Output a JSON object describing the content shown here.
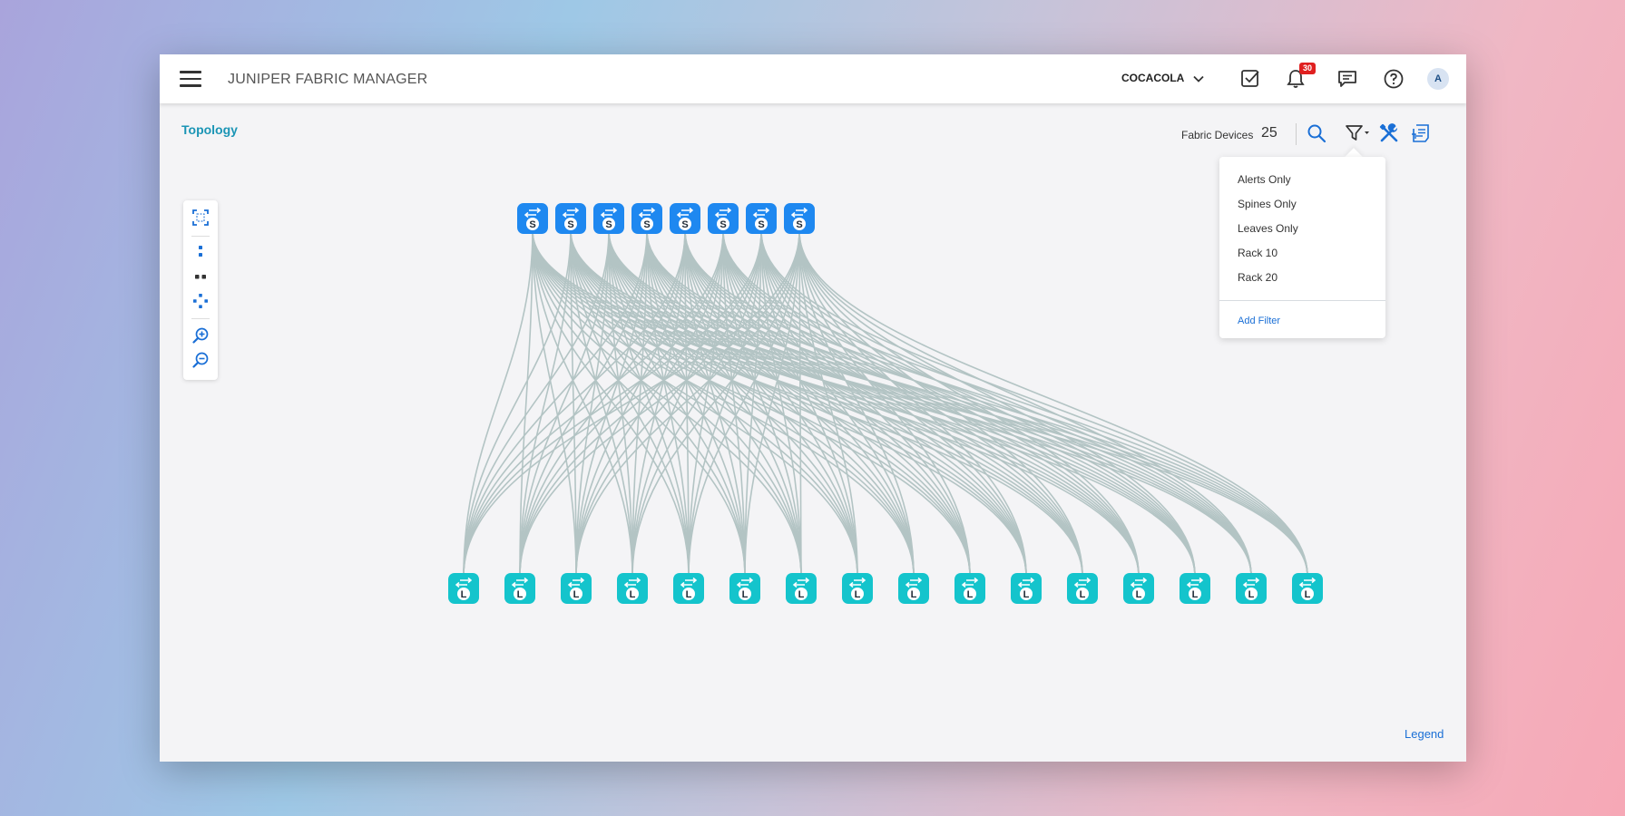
{
  "app": {
    "title": "JUNIPER FABRIC MANAGER",
    "tenant": "COCACOLA",
    "notification_count": "30",
    "user_initial": "A"
  },
  "page": {
    "title": "Topology",
    "fabric_devices_label": "Fabric Devices",
    "fabric_devices_count": "25"
  },
  "filter_menu": {
    "items": [
      "Alerts Only",
      "Spines Only",
      "Leaves Only",
      "Rack 10",
      "Rack 20"
    ],
    "add_filter": "Add Filter"
  },
  "topology": {
    "spines": [
      {
        "label": "S"
      },
      {
        "label": "S"
      },
      {
        "label": "S"
      },
      {
        "label": "S"
      },
      {
        "label": "S"
      },
      {
        "label": "S"
      },
      {
        "label": "S"
      },
      {
        "label": "S"
      }
    ],
    "leaves": [
      {
        "label": "L"
      },
      {
        "label": "L"
      },
      {
        "label": "L"
      },
      {
        "label": "L"
      },
      {
        "label": "L"
      },
      {
        "label": "L"
      },
      {
        "label": "L"
      },
      {
        "label": "L"
      },
      {
        "label": "L"
      },
      {
        "label": "L"
      },
      {
        "label": "L"
      },
      {
        "label": "L"
      },
      {
        "label": "L"
      },
      {
        "label": "L"
      },
      {
        "label": "L"
      },
      {
        "label": "L"
      }
    ],
    "link_color": "#b3c4c4",
    "spine_color": "#1e88f0",
    "leaf_color": "#14c4cc"
  },
  "legend_label": "Legend",
  "colors": {
    "accent": "#1a6fd6",
    "title_teal": "#1b95b5",
    "badge_red": "#e02020"
  }
}
